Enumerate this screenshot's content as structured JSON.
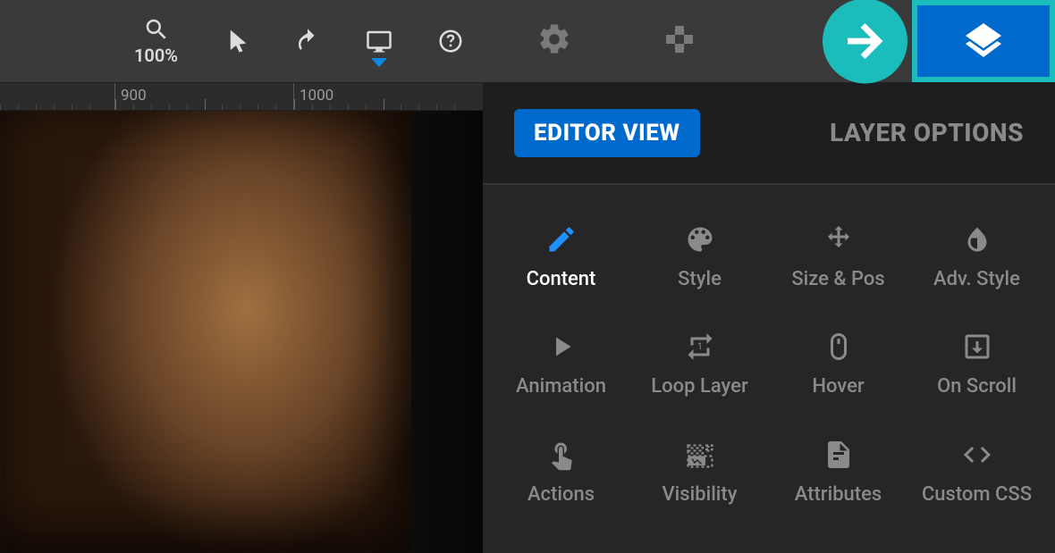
{
  "toolbar": {
    "zoom_label": "100%",
    "ruler_ticks": [
      "900",
      "1000"
    ]
  },
  "panel": {
    "editor_view_label": "EDITOR VIEW",
    "layer_options_label": "LAYER OPTIONS",
    "options": {
      "content": "Content",
      "style": "Style",
      "size_pos": "Size & Pos",
      "adv_style": "Adv. Style",
      "animation": "Animation",
      "loop_layer": "Loop Layer",
      "hover": "Hover",
      "on_scroll": "On Scroll",
      "actions": "Actions",
      "visibility": "Visibility",
      "attributes": "Attributes",
      "custom_css": "Custom CSS"
    }
  }
}
